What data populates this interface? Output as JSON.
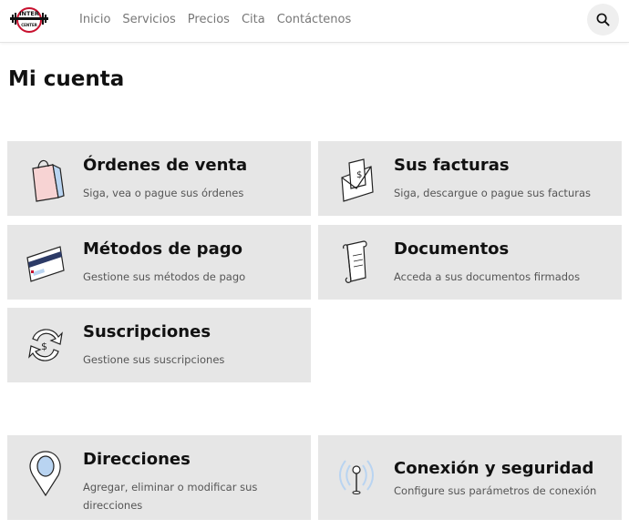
{
  "logo": {
    "top": "INTER",
    "bottom": "CENTER"
  },
  "nav": {
    "links": [
      "Inicio",
      "Servicios",
      "Precios",
      "Cita",
      "Contáctenos"
    ]
  },
  "page": {
    "title": "Mi cuenta"
  },
  "cards": [
    {
      "title": "Órdenes de venta",
      "desc": "Siga, vea o pague sus órdenes",
      "icon": "shopping-bag-icon"
    },
    {
      "title": "Sus facturas",
      "desc": "Siga, descargue o pague sus facturas",
      "icon": "invoice-envelope-icon"
    },
    {
      "title": "Métodos de pago",
      "desc": "Gestione sus métodos de pago",
      "icon": "credit-card-icon"
    },
    {
      "title": "Documentos",
      "desc": "Acceda a sus documentos firmados",
      "icon": "document-scroll-icon"
    },
    {
      "title": "Suscripciones",
      "desc": "Gestione sus suscripciones",
      "icon": "subscription-cycle-icon"
    },
    {
      "title": "Direcciones",
      "desc": "Agregar, eliminar o modificar sus direcciones",
      "icon": "location-pin-icon"
    },
    {
      "title": "Conexión y seguridad",
      "desc": "Configure sus parámetros de conexión",
      "icon": "antenna-signal-icon"
    }
  ],
  "colors": {
    "card_bg": "#e6e6e6",
    "logo_red": "#c8102e",
    "accent_blue": "#b9d4f1",
    "accent_pink": "#f7d3d3"
  }
}
